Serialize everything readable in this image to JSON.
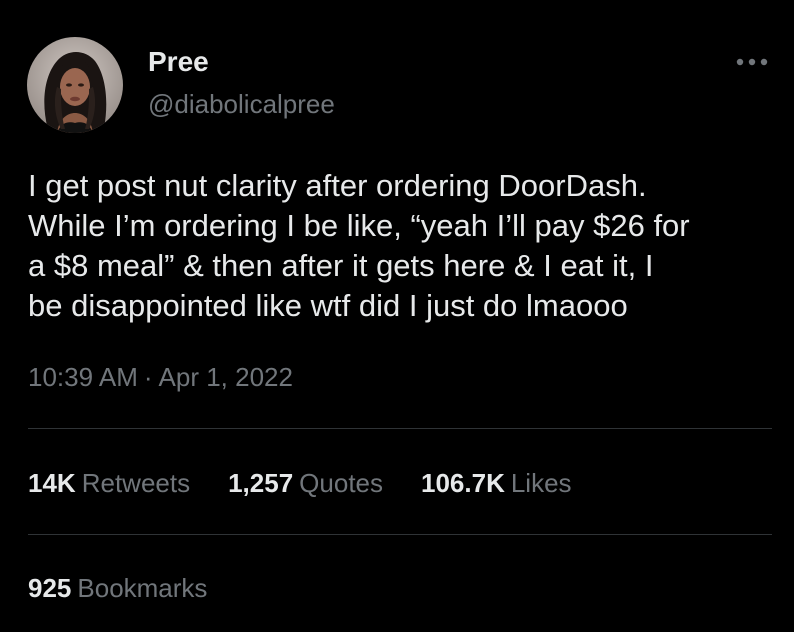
{
  "author": {
    "display_name": "Pree",
    "handle": "@diabolicalpree",
    "avatar_icon": "profile-photo"
  },
  "tweet": {
    "text": "I get post nut clarity after ordering DoorDash.\nWhile I’m ordering I be like, “yeah I’ll pay $26 for\na $8 meal” & then after it gets here & I eat it, I\nbe disappointed like wtf did I just do lmaooo",
    "time": "10:39 AM",
    "separator": "·",
    "date": "Apr 1, 2022"
  },
  "stats": {
    "retweets": {
      "count": "14K",
      "label": "Retweets"
    },
    "quotes": {
      "count": "1,257",
      "label": "Quotes"
    },
    "likes": {
      "count": "106.7K",
      "label": "Likes"
    },
    "bookmarks": {
      "count": "925",
      "label": "Bookmarks"
    }
  },
  "menu": {
    "more_icon": "more-horizontal-icon"
  },
  "colors": {
    "background": "#000000",
    "primary_text": "#e7e9ea",
    "secondary_text": "#71767b",
    "divider": "#2f3336"
  }
}
